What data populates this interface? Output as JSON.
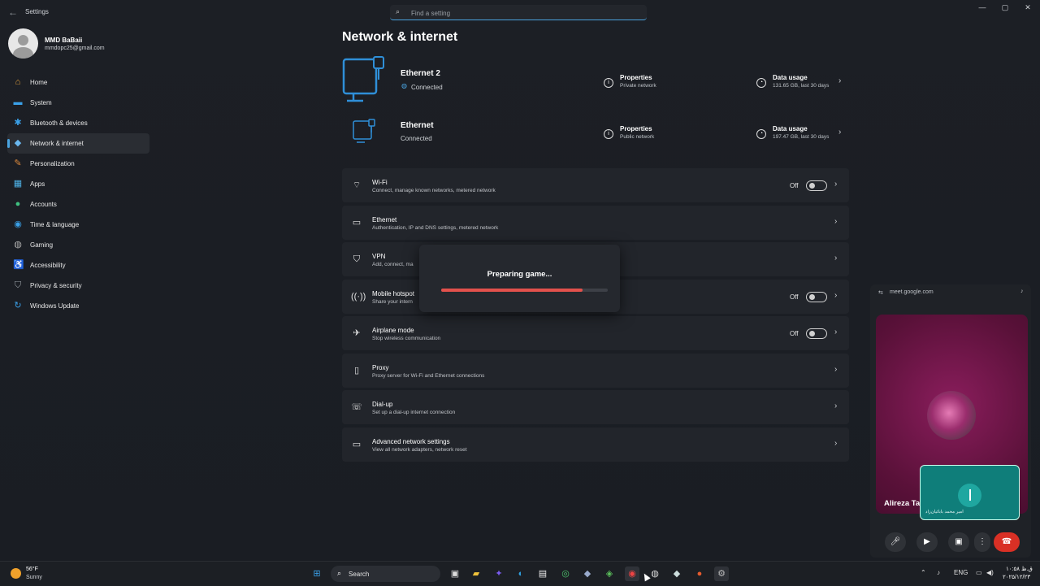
{
  "window": {
    "title": "Settings",
    "search_placeholder": "Find a setting"
  },
  "profile": {
    "name": "MMD BaBaii",
    "email": "mmdopc25@gmail.com"
  },
  "nav": [
    {
      "label": "Home",
      "icon": "home-icon",
      "color": "#e8a33d"
    },
    {
      "label": "System",
      "icon": "monitor-icon",
      "color": "#3aa0e8"
    },
    {
      "label": "Bluetooth & devices",
      "icon": "bluetooth-icon",
      "color": "#3aa0e8"
    },
    {
      "label": "Network & internet",
      "icon": "wifi-icon",
      "color": "#6ab7ef",
      "active": true
    },
    {
      "label": "Personalization",
      "icon": "brush-icon",
      "color": "#e08a3c"
    },
    {
      "label": "Apps",
      "icon": "apps-icon",
      "color": "#4fb3e8"
    },
    {
      "label": "Accounts",
      "icon": "person-icon",
      "color": "#3fbf7f"
    },
    {
      "label": "Time & language",
      "icon": "globe-icon",
      "color": "#3aa0e8"
    },
    {
      "label": "Gaming",
      "icon": "gamepad-icon",
      "color": "#b0b0b0"
    },
    {
      "label": "Accessibility",
      "icon": "accessibility-icon",
      "color": "#3aa0e8"
    },
    {
      "label": "Privacy & security",
      "icon": "shield-icon",
      "color": "#9aa0a6"
    },
    {
      "label": "Windows Update",
      "icon": "update-icon",
      "color": "#3aa0e8"
    }
  ],
  "page": {
    "title": "Network & internet"
  },
  "connections": [
    {
      "name": "Ethernet 2",
      "status": "Connected",
      "prop_title": "Properties",
      "prop_sub": "Private network",
      "usage_title": "Data usage",
      "usage_sub": "131.65 GB, last 30 days"
    },
    {
      "name": "Ethernet",
      "status": "Connected",
      "prop_title": "Properties",
      "prop_sub": "Public network",
      "usage_title": "Data usage",
      "usage_sub": "197.47 GB, last 30 days"
    }
  ],
  "settings": [
    {
      "title": "Wi-Fi",
      "sub": "Connect, manage known networks, metered network",
      "icon": "wifi-icon",
      "state": "Off"
    },
    {
      "title": "Ethernet",
      "sub": "Authentication, IP and DNS settings, metered network",
      "icon": "ethernet-icon"
    },
    {
      "title": "VPN",
      "sub": "Add, connect, ma",
      "icon": "vpn-shield-icon"
    },
    {
      "title": "Mobile hotspot",
      "sub": "Share your intern",
      "icon": "hotspot-icon",
      "state": "Off"
    },
    {
      "title": "Airplane mode",
      "sub": "Stop wireless communication",
      "icon": "airplane-icon",
      "state": "Off"
    },
    {
      "title": "Proxy",
      "sub": "Proxy server for Wi-Fi and Ethernet connections",
      "icon": "proxy-icon"
    },
    {
      "title": "Dial-up",
      "sub": "Set up a dial-up internet connection",
      "icon": "dialup-icon"
    },
    {
      "title": "Advanced network settings",
      "sub": "View all network adapters, network reset",
      "icon": "monitor-network-icon"
    }
  ],
  "overlay": {
    "text": "Preparing game...",
    "progress": 0.85,
    "color": "#e3514c"
  },
  "meet": {
    "url": "meet.google.com",
    "participant": "Alireza Ta",
    "self_name": "امیر محمد بابائیان‌زاد"
  },
  "taskbar": {
    "weather_temp": "56°F",
    "weather_cond": "Sunny",
    "search_label": "Search",
    "language": "ENG",
    "time": "۱۰:۵۸ ق.ظ",
    "date": "۲۰۲۵/۱۲/۲۳"
  }
}
